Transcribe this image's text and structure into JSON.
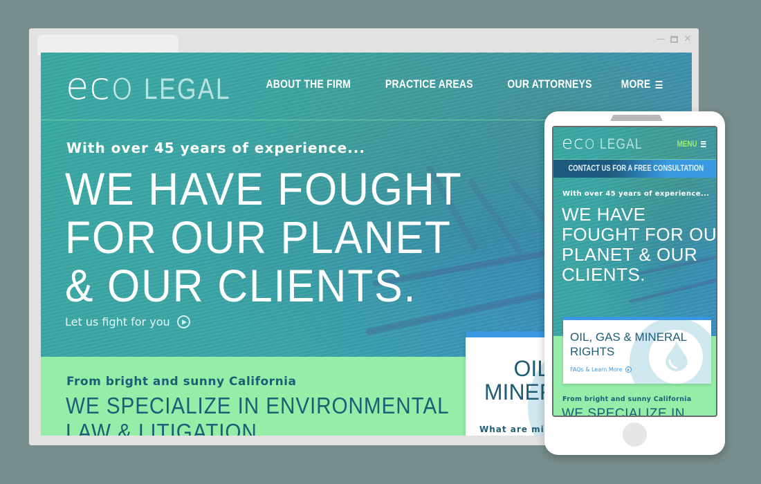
{
  "desktop": {
    "window_controls": [
      "minimize",
      "maximize",
      "close"
    ],
    "logo": {
      "eco": "ec",
      "eco_o": "o",
      "legal": "LEGAL"
    },
    "nav": {
      "items": [
        {
          "label": "ABOUT THE FIRM"
        },
        {
          "label": "PRACTICE AREAS"
        },
        {
          "label": "OUR ATTORNEYS"
        },
        {
          "label": "MORE",
          "icon": "menu-icon"
        }
      ]
    },
    "hero": {
      "tagline": "With over 45 years of experience...",
      "headline_lines": [
        "WE HAVE FOUGHT",
        "FOR OUR PLANET",
        "& OUR CLIENTS."
      ],
      "cta": "Let us fight for you",
      "cta_icon": "play-circle-icon"
    },
    "specialize": {
      "subtitle": "From bright and sunny California",
      "headline_lines": [
        "WE SPECIALIZE IN ENVIRONMENTAL",
        "LAW & LITIGATION"
      ]
    },
    "card": {
      "title_lines": [
        "OIL,",
        "MINER"
      ],
      "question": "What are min"
    }
  },
  "mobile": {
    "logo": {
      "eco": "ec",
      "eco_o": "o",
      "legal": "LEGAL"
    },
    "menu_label": "MENU",
    "contact_banner": "CONTACT US FOR A FREE CONSULTATION",
    "hero": {
      "tagline": "With over 45 years of experience...",
      "headline_lines": [
        "WE HAVE",
        "FOUGHT FOR OUR",
        "PLANET & OUR",
        "CLIENTS."
      ]
    },
    "card": {
      "title_lines": [
        "OIL, GAS & MINERAL",
        "RIGHTS"
      ],
      "link": "FAQs & Learn More",
      "icon": "water-drop-icon"
    },
    "specialize": {
      "subtitle": "From bright and sunny California",
      "headline": "WE SPECIALIZE IN"
    }
  },
  "colors": {
    "background": "#788d8d",
    "teal": "#3aa3a8",
    "green": "#94eea8",
    "navy_text": "#1f5c76",
    "accent_blue": "#3a98e2",
    "menu_green": "#9af06e"
  }
}
